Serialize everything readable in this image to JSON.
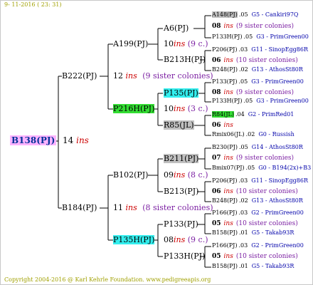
{
  "date": "9- 11-2016 ( 23: 31)",
  "footer": "Copyright 2004-2016 @ Karl Kehrle Foundation.   www.pedigreeapis.org",
  "root": {
    "name": "B138(PJ)",
    "gen": "14",
    "ins": "ins"
  },
  "g1": {
    "a": {
      "name": "B222(PJ)"
    },
    "b": {
      "name": "B184(PJ)"
    }
  },
  "g2": {
    "a": {
      "name": "A199(PJ)",
      "gen": "12",
      "ins": "ins",
      "sis": "(9 sister colonies)"
    },
    "b": {
      "name": "P216H(PJ)",
      "gen": "10",
      "ins": "ins",
      "sis": "(3 c.)"
    },
    "c": {
      "name": "B102(PJ)",
      "gen": "11",
      "ins": "ins",
      "sis": "(8 sister colonies)"
    },
    "d": {
      "name": "P135H(PJ)",
      "gen": "08",
      "ins": "ins",
      "sis": "(9 c.)"
    }
  },
  "g3": {
    "a": {
      "name": "A6(PJ)"
    },
    "a_gen": {
      "gen": "10",
      "ins": "ins",
      "sis": "(9 c.)"
    },
    "b": {
      "name": "B213H(PJ)"
    },
    "c": {
      "name": "P135(PJ)"
    },
    "c_gen": {
      "gen": "10",
      "ins": "ins",
      "sis": "(3 c.)"
    },
    "d": {
      "name": "R85(JL)"
    },
    "e": {
      "name": "B211(PJ)"
    },
    "e_gen": {
      "gen": "09",
      "ins": "ins",
      "sis": "(8 c.)"
    },
    "f": {
      "name": "B213(PJ)"
    },
    "g": {
      "name": "P133(PJ)"
    },
    "g_gen": {
      "gen": "08",
      "ins": "ins",
      "sis": "(9 c.)"
    },
    "h": {
      "name": "P133H(PJ)"
    }
  },
  "g4": [
    {
      "name": "A148(PJ)",
      "num": ".05",
      "line": "G5 - Cankiri97Q"
    },
    {
      "gen": "08",
      "ins": "ins",
      "sis": "(9 sister colonies)"
    },
    {
      "name": "P133H(PJ)",
      "num": ".05",
      "line": "G3 - PrimGreen00"
    },
    {
      "name": "P206(PJ)",
      "num": ".03",
      "line": "G11 - SinopEgg86R"
    },
    {
      "gen": "06",
      "ins": "ins",
      "sis": "(10 sister colonies)"
    },
    {
      "name": "B248(PJ)",
      "num": ".02",
      "line": "G13 - AthosSt80R"
    },
    {
      "name": "P133(PJ)",
      "num": ".05",
      "line": "G3 - PrimGreen00"
    },
    {
      "gen": "08",
      "ins": "ins",
      "sis": "(9 sister colonies)"
    },
    {
      "name": "P133H(PJ)",
      "num": ".05",
      "line": "G3 - PrimGreen00"
    },
    {
      "name": "R84(JL)",
      "num": ".04",
      "line": "G2 - PrimRed01"
    },
    {
      "gen": "06",
      "ins": "ins",
      "sis": ""
    },
    {
      "name": "Rmix06(JL)",
      "num": ".02",
      "line": "G0 - Russish"
    },
    {
      "name": "B230(PJ)",
      "num": ".05",
      "line": "G14 - AthosSt80R"
    },
    {
      "gen": "07",
      "ins": "ins",
      "sis": "(9 sister colonies)"
    },
    {
      "name": "Bmix07(PJ)",
      "num": ".05",
      "line": "G0 - B194(2x)+B3"
    },
    {
      "name": "P206(PJ)",
      "num": ".03",
      "line": "G11 - SinopEgg86R"
    },
    {
      "gen": "06",
      "ins": "ins",
      "sis": "(10 sister colonies)"
    },
    {
      "name": "B248(PJ)",
      "num": ".02",
      "line": "G13 - AthosSt80R"
    },
    {
      "name": "P166(PJ)",
      "num": ".03",
      "line": "G2 - PrimGreen00"
    },
    {
      "gen": "05",
      "ins": "ins",
      "sis": "(10 sister colonies)"
    },
    {
      "name": "B158(PJ)",
      "num": ".01",
      "line": "G5 - Takab93R"
    },
    {
      "name": "P166(PJ)",
      "num": ".03",
      "line": "G2 - PrimGreen00"
    },
    {
      "gen": "05",
      "ins": "ins",
      "sis": "(10 sister colonies)"
    },
    {
      "name": "B158(PJ)",
      "num": ".01",
      "line": "G5 - Takab93R"
    }
  ]
}
